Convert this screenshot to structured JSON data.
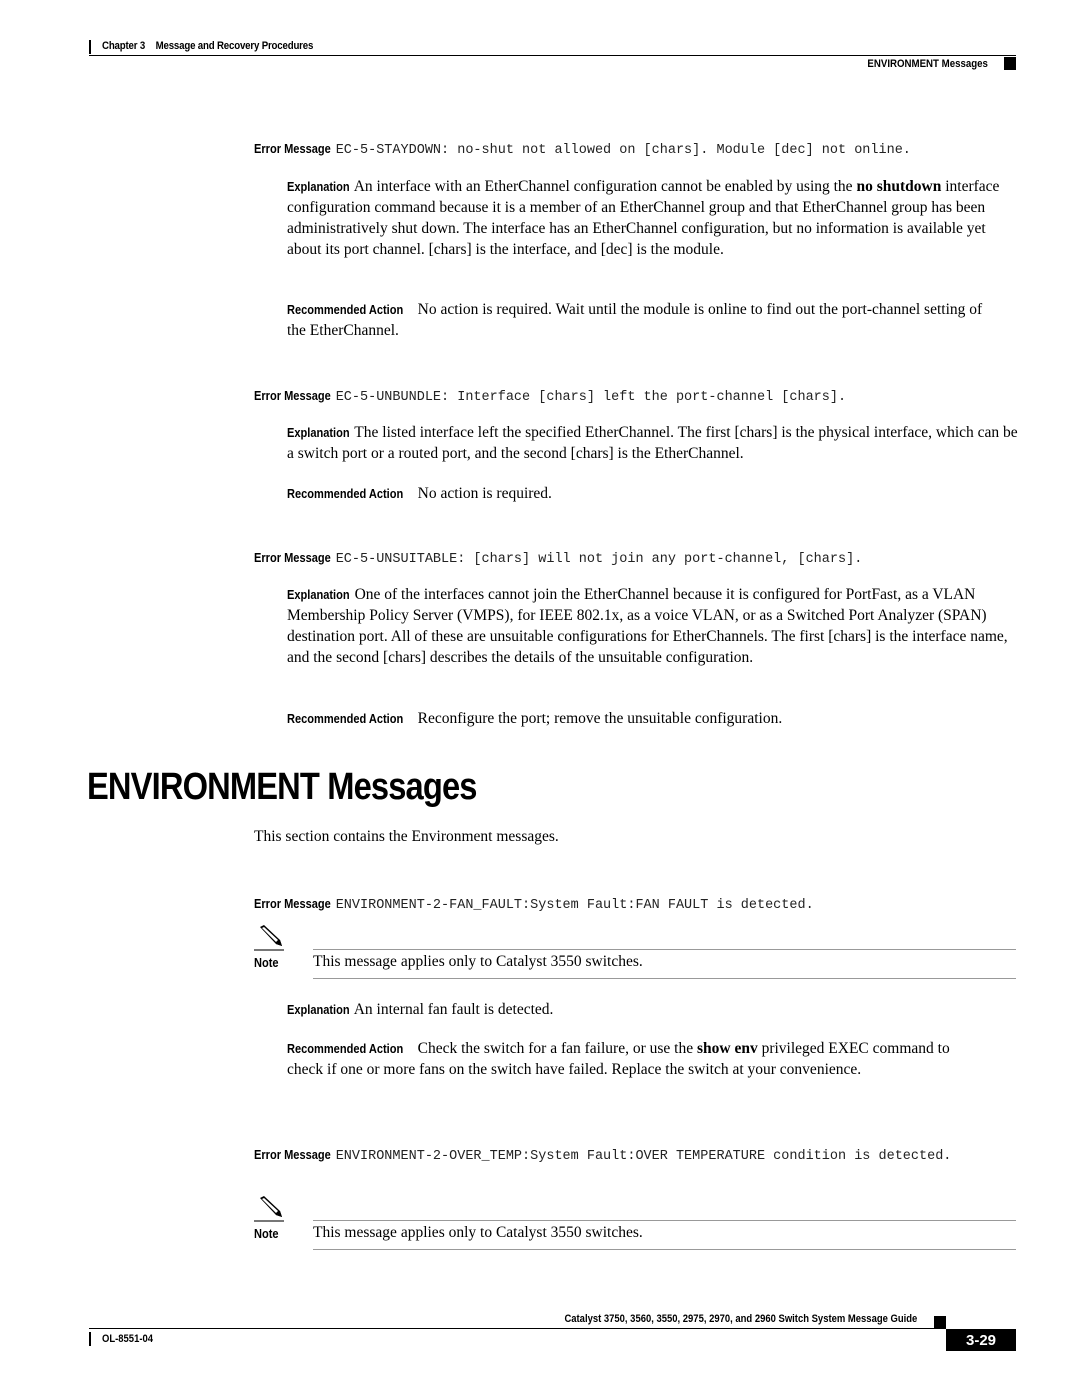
{
  "header": {
    "chapter": "Chapter 3",
    "chapter_title": "Message and Recovery Procedures",
    "section": "ENVIRONMENT Messages"
  },
  "labels": {
    "error_message": "Error Message",
    "explanation": "Explanation",
    "recommended_action": "Recommended Action",
    "note": "Note"
  },
  "messages": [
    {
      "code": "EC-5-STAYDOWN: no-shut not allowed on [chars]. Module [dec] not online.",
      "explanation_pre": "An interface with an EtherChannel configuration cannot be enabled by using the ",
      "explanation_bold": "no shutdown",
      "explanation_post": " interface configuration command because it is a member of an EtherChannel group and that EtherChannel group has been administratively shut down. The interface has an EtherChannel configuration, but no information is available yet about its port channel. [chars] is the interface, and [dec] is the module.",
      "action": "No action is required. Wait until the module is online to find out the port-channel setting of the EtherChannel."
    },
    {
      "code": "EC-5-UNBUNDLE: Interface [chars] left the port-channel [chars].",
      "explanation": "The listed interface left the specified EtherChannel. The first [chars] is the physical interface, which can be a switch port or a routed port, and the second [chars] is the EtherChannel.",
      "action": "No action is required."
    },
    {
      "code": "EC-5-UNSUITABLE: [chars] will not join any port-channel, [chars].",
      "explanation": "One of the interfaces cannot join the EtherChannel because it is configured for PortFast, as a VLAN Membership Policy Server (VMPS), for IEEE 802.1x, as a voice VLAN, or as a Switched Port Analyzer (SPAN) destination port. All of these are unsuitable configurations for EtherChannels. The first [chars] is the interface name, and the second [chars] describes the details of the unsuitable configuration.",
      "action": "Reconfigure the port; remove the unsuitable configuration."
    }
  ],
  "section": {
    "title": "ENVIRONMENT Messages",
    "intro": "This section contains the Environment messages.",
    "messages": [
      {
        "code": "ENVIRONMENT-2-FAN_FAULT:System Fault:FAN FAULT is detected.",
        "note": "This message applies only to Catalyst 3550 switches.",
        "explanation": "An internal fan fault is detected.",
        "action_pre": "Check the switch for a fan failure, or use the ",
        "action_bold": "show env",
        "action_post": " privileged EXEC command to check if one or more fans on the switch have failed. Replace the switch at your convenience."
      },
      {
        "code": "ENVIRONMENT-2-OVER_TEMP:System Fault:OVER TEMPERATURE condition is detected.",
        "note": "This message applies only to Catalyst 3550 switches."
      }
    ]
  },
  "footer": {
    "guide_title": "Catalyst 3750, 3560, 3550, 2975, 2970, and 2960 Switch System Message Guide",
    "doc_number": "OL-8551-04",
    "page_number": "3-29"
  }
}
